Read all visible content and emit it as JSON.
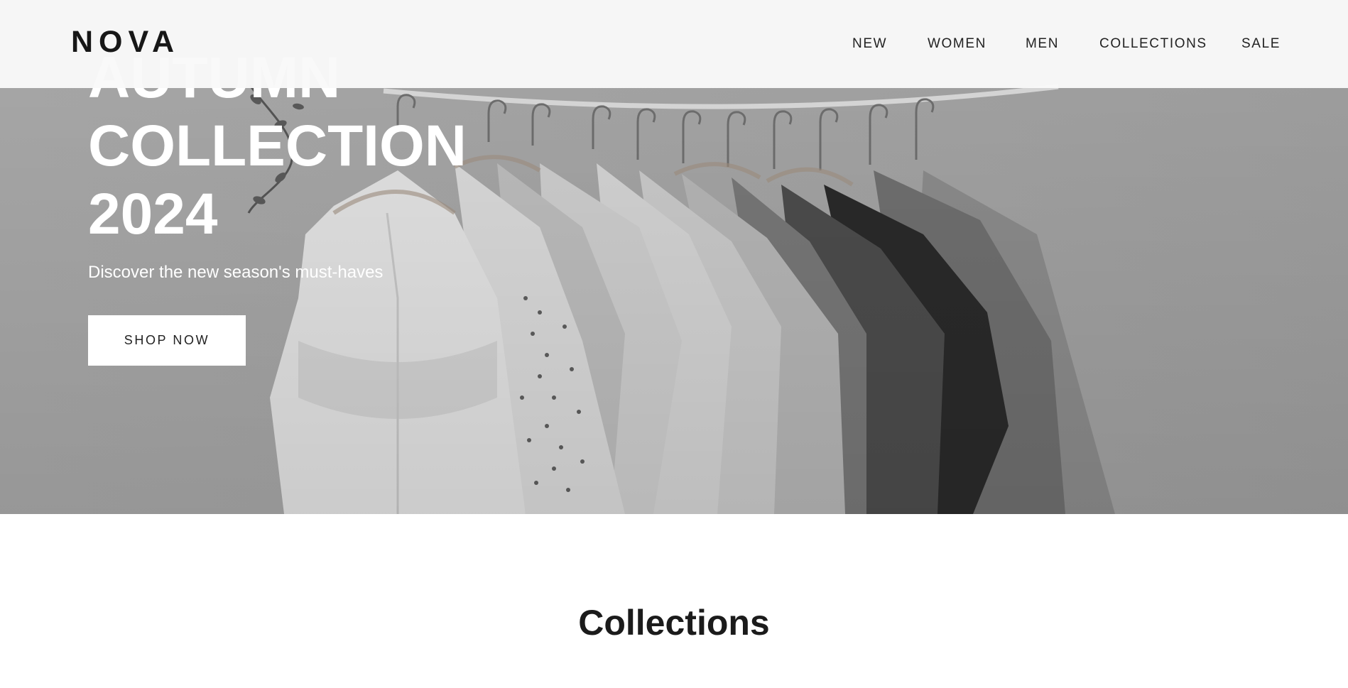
{
  "header": {
    "logo": "NOVA",
    "nav": [
      {
        "label": "NEW"
      },
      {
        "label": "WOMEN"
      },
      {
        "label": "MEN"
      },
      {
        "label": "COLLECTIONS"
      },
      {
        "label": "SALE"
      }
    ]
  },
  "hero": {
    "title_lines": [
      "AUTUMN",
      "COLLECTION",
      "2024"
    ],
    "subtitle": "Discover the new season's must-haves",
    "cta_label": "SHOP NOW",
    "image": "clothes-on-hangers-photo"
  },
  "collections": {
    "heading": "Collections"
  },
  "colors": {
    "header_bg": "#f9f9f9",
    "text_dark": "#1b1b1b",
    "hero_overlay": "#a2a2a2",
    "button_bg": "#ffffff"
  }
}
